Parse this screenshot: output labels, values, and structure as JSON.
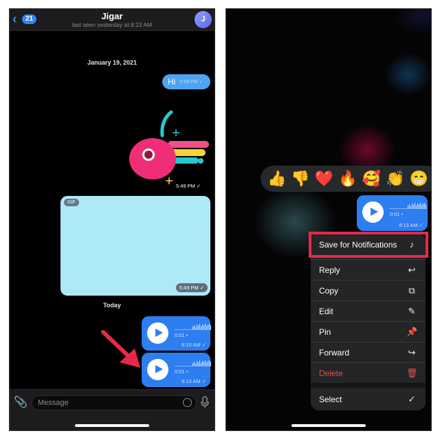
{
  "left": {
    "header": {
      "back_count": "21",
      "title": "Jigar",
      "subtitle": "last seen yesterday at 8:23 AM",
      "avatar_initial": "J"
    },
    "date_separators": [
      "January 19, 2021",
      "Today"
    ],
    "messages": [
      {
        "type": "text",
        "text": "Hi",
        "time": "5:49 PM",
        "status": "sent-check"
      },
      {
        "type": "sticker",
        "description": "pink cherry sticker",
        "time": "5:49 PM",
        "status": "sent-check"
      },
      {
        "type": "gif",
        "tag": "GIF",
        "time": "5:49 PM",
        "status": "sent-check"
      },
      {
        "type": "voice",
        "duration": "0:01",
        "time": "8:10 AM",
        "status": "sent-check"
      },
      {
        "type": "voice",
        "duration": "0:01",
        "time": "8:13 AM",
        "status": "sent-check"
      }
    ],
    "annotation": {
      "type": "arrow",
      "color": "#e8284a",
      "points_to": "second voice message"
    },
    "input": {
      "placeholder": "Message",
      "value": ""
    },
    "icons": {
      "attach": "paperclip-icon",
      "sticker": "sticker-icon",
      "mic": "microphone-icon"
    }
  },
  "right": {
    "reactions": [
      "👍",
      "👎",
      "❤️",
      "🔥",
      "🥰",
      "👏",
      "😁"
    ],
    "voice_message": {
      "duration": "0:01",
      "time": "8:13 AM",
      "status": "sent-check"
    },
    "context_menu": [
      {
        "label": "Save for Notifications",
        "icon": "♪",
        "icon_name": "save-notification-sound-icon",
        "highlighted": true
      },
      {
        "label": "Reply",
        "icon": "↩",
        "icon_name": "reply-icon"
      },
      {
        "label": "Copy",
        "icon": "⧉",
        "icon_name": "copy-icon"
      },
      {
        "label": "Edit",
        "icon": "✎",
        "icon_name": "edit-icon"
      },
      {
        "label": "Pin",
        "icon": "📌",
        "icon_name": "pin-icon"
      },
      {
        "label": "Forward",
        "icon": "↪",
        "icon_name": "forward-icon"
      },
      {
        "label": "Delete",
        "icon": "🗑",
        "icon_name": "trash-icon",
        "destructive": true
      },
      {
        "label": "Select",
        "icon": "✓",
        "icon_name": "select-check-icon"
      }
    ]
  },
  "colors": {
    "accent": "#2d7ef0",
    "bubble_light": "#4ea3f3",
    "gif_bg": "#aee9f8",
    "highlight": "#e8284a",
    "destructive": "#e0504e"
  },
  "check": "✓"
}
